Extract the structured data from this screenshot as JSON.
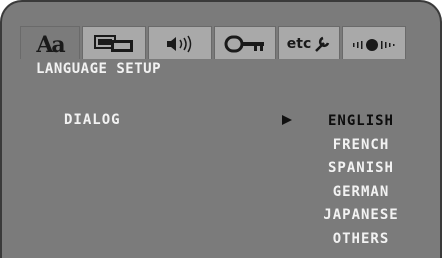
{
  "tabs": [
    {
      "name": "language",
      "icon": "language-icon",
      "label": "Aa",
      "active": true
    },
    {
      "name": "display",
      "icon": "display-icon",
      "active": false
    },
    {
      "name": "audio",
      "icon": "speaker-icon",
      "active": false
    },
    {
      "name": "parental",
      "icon": "key-icon",
      "active": false
    },
    {
      "name": "etc",
      "icon": "wrench-icon",
      "label": "etc",
      "active": false
    },
    {
      "name": "setup-level",
      "icon": "level-icon",
      "active": false
    }
  ],
  "menu": {
    "title": "LANGUAGE SETUP",
    "item_label": "DIALOG",
    "selected_index": 0,
    "options": [
      "ENGLISH",
      "FRENCH",
      "SPANISH",
      "GERMAN",
      "JAPANESE",
      "OTHERS"
    ]
  }
}
